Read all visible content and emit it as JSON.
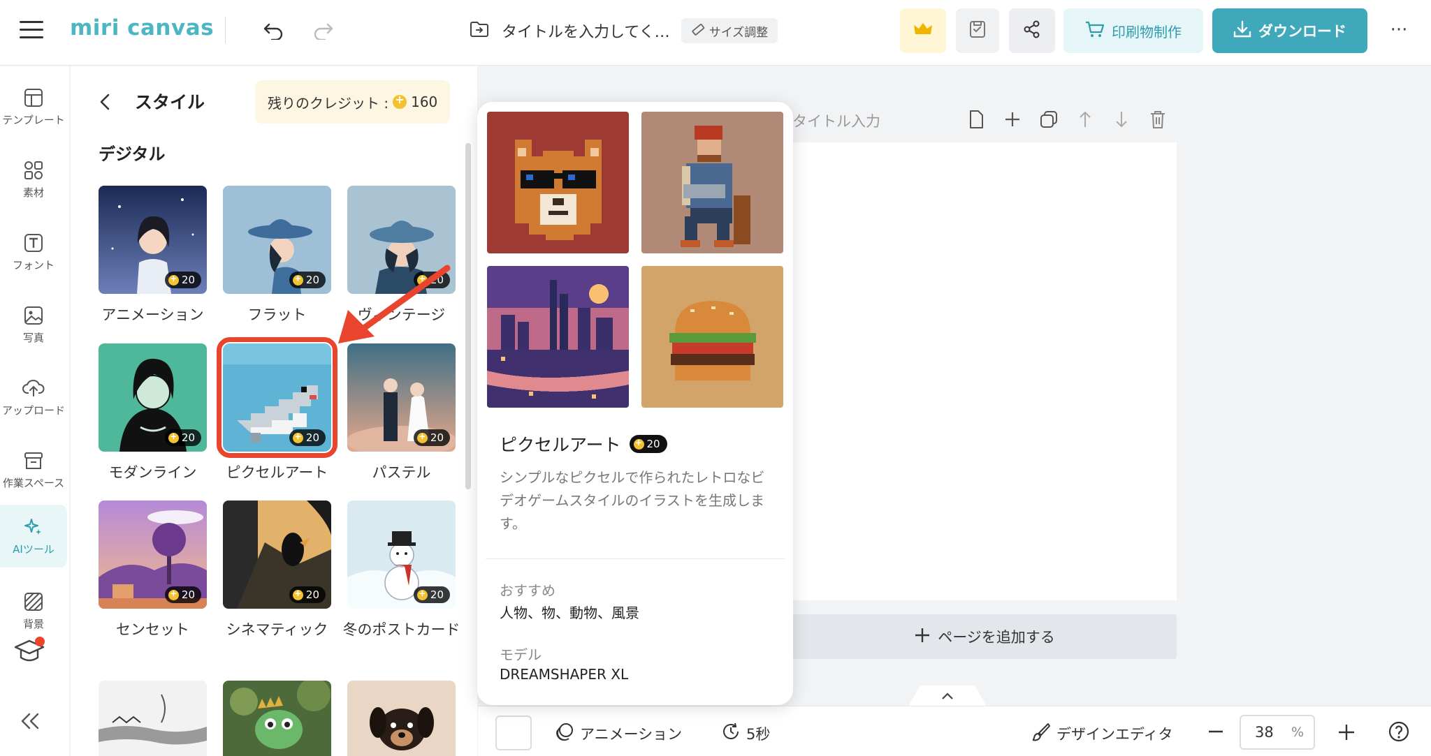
{
  "header": {
    "logo": "miri canvas",
    "document_title": "タイトルを入力してく…",
    "size_button": "サイズ調整",
    "print_button": "印刷物制作",
    "download_button": "ダウンロード",
    "more": "···"
  },
  "rail": {
    "items": [
      {
        "label": "テンプレート",
        "icon": "template-icon"
      },
      {
        "label": "素材",
        "icon": "elements-icon"
      },
      {
        "label": "フォント",
        "icon": "text-icon"
      },
      {
        "label": "写真",
        "icon": "photo-icon"
      },
      {
        "label": "アップロード",
        "icon": "upload-icon"
      },
      {
        "label": "作業スペース",
        "icon": "workspace-icon"
      },
      {
        "label": "AIツール",
        "icon": "ai-tools-icon"
      },
      {
        "label": "背景",
        "icon": "background-icon"
      }
    ],
    "active_index": 6
  },
  "panel": {
    "title": "スタイル",
    "credits_label": "残りのクレジット :",
    "credits_value": "160",
    "section_title": "デジタル",
    "styles": [
      {
        "label": "アニメーション",
        "cost": "20"
      },
      {
        "label": "フラット",
        "cost": "20"
      },
      {
        "label": "ヴィンテージ",
        "cost": "20"
      },
      {
        "label": "モダンライン",
        "cost": "20"
      },
      {
        "label": "ピクセルアート",
        "cost": "20"
      },
      {
        "label": "パステル",
        "cost": "20"
      },
      {
        "label": "センセット",
        "cost": "20"
      },
      {
        "label": "シネマティック",
        "cost": "20"
      },
      {
        "label": "冬のポストカード",
        "cost": "20"
      }
    ],
    "selected_index": 4
  },
  "popover": {
    "name": "ピクセルアート",
    "cost": "20",
    "description": "シンプルなピクセルで作られたレトロなビデオゲームスタイルのイラストを生成します。",
    "recommend_label": "おすすめ",
    "recommend_value": "人物、物、動物、風景",
    "model_label": "モデル",
    "model_value": "DREAMSHAPER XL"
  },
  "canvas": {
    "page_title_placeholder": "タイトル入力",
    "add_page": "ページを追加する"
  },
  "bottombar": {
    "animation": "アニメーション",
    "duration": "5秒",
    "design_editor": "デザインエディタ",
    "zoom": "38",
    "zoom_unit": "%"
  },
  "colors": {
    "brand": "#3fa9bb",
    "selection": "#e8442e",
    "arrow": "#e8442e"
  }
}
